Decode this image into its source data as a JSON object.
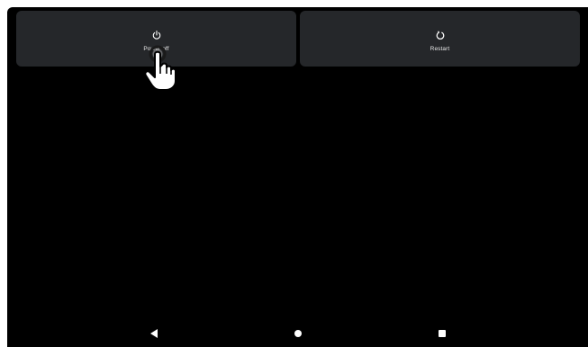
{
  "power_menu": {
    "options": [
      {
        "label": "Power off",
        "icon": "power-icon"
      },
      {
        "label": "Restart",
        "icon": "restart-icon"
      }
    ]
  },
  "nav_bar": {
    "buttons": [
      {
        "name": "back",
        "icon": "back-triangle-icon"
      },
      {
        "name": "home",
        "icon": "home-circle-icon"
      },
      {
        "name": "recents",
        "icon": "recents-square-icon"
      }
    ]
  },
  "colors": {
    "background": "#000000",
    "tile": "#25272a",
    "text": "#e8e8e8",
    "icon": "#ffffff"
  }
}
